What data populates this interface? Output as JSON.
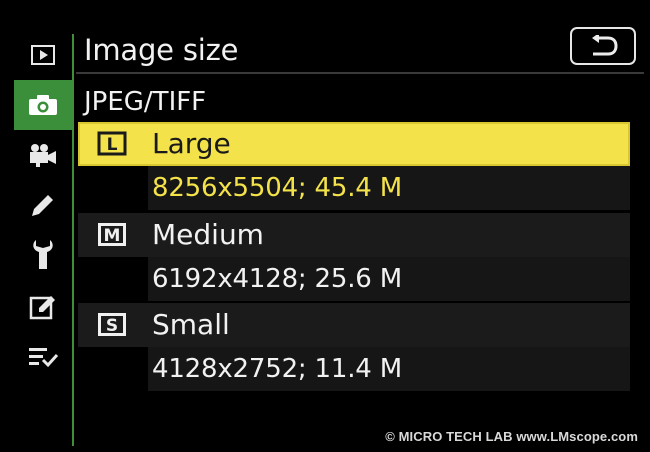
{
  "header": {
    "title": "Image size"
  },
  "section": {
    "label": "JPEG/TIFF"
  },
  "sidebar": {
    "items": [
      {
        "icon": "playback-icon",
        "active": false
      },
      {
        "icon": "camera-icon",
        "active": true
      },
      {
        "icon": "movie-camera-icon",
        "active": false
      },
      {
        "icon": "pencil-icon",
        "active": false
      },
      {
        "icon": "wrench-icon",
        "active": false
      },
      {
        "icon": "retouch-icon",
        "active": false
      },
      {
        "icon": "my-menu-icon",
        "active": false
      }
    ]
  },
  "options": [
    {
      "badge": "L",
      "label": "Large",
      "detail": "8256x5504; 45.4 M",
      "selected": true
    },
    {
      "badge": "M",
      "label": "Medium",
      "detail": "6192x4128; 25.6 M",
      "selected": false
    },
    {
      "badge": "S",
      "label": "Small",
      "detail": "4128x2752; 11.4 M",
      "selected": false
    }
  ],
  "watermark": "© MICRO TECH LAB   www.LMscope.com",
  "colors": {
    "highlight": "#f3e24a",
    "active_tab": "#3c8f3a",
    "background": "#000000"
  }
}
